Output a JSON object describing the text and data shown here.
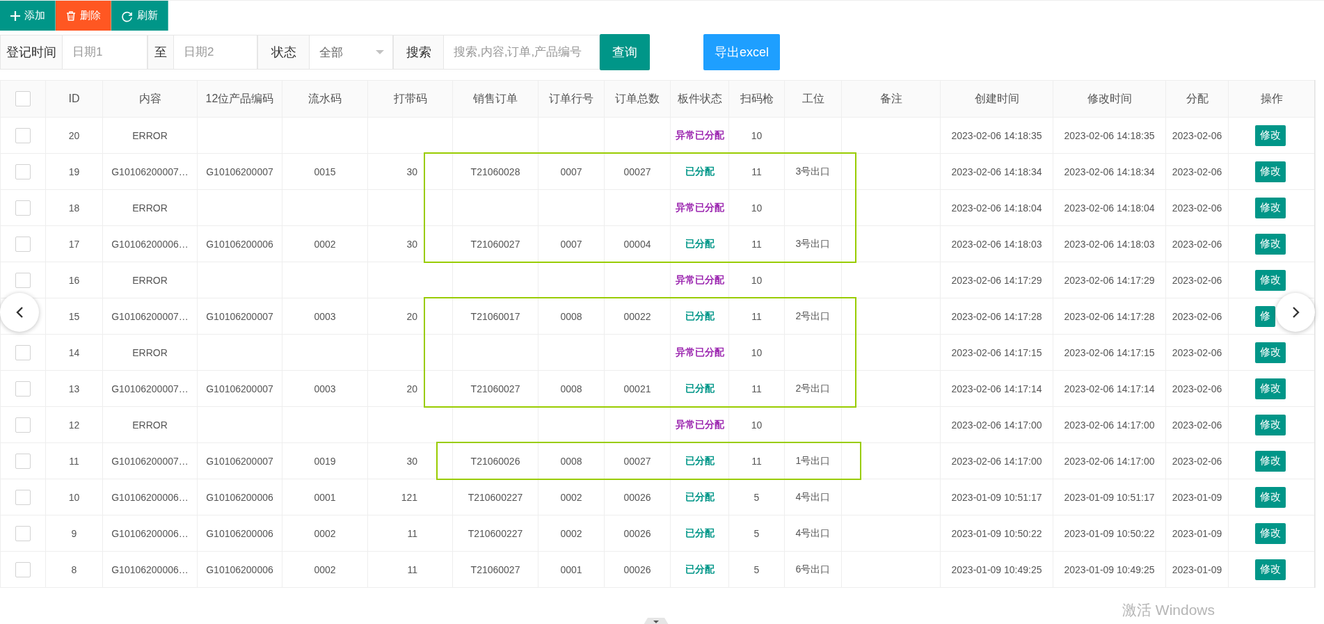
{
  "toolbar": [
    {
      "label": "添加",
      "kind": "add"
    },
    {
      "label": "删除",
      "kind": "delete"
    },
    {
      "label": "刷新",
      "kind": "refresh"
    }
  ],
  "filters": {
    "date_label": "登记时间",
    "date_from": {
      "placeholder": "日期1"
    },
    "range_separator": "至",
    "date_to": {
      "placeholder": "日期2"
    },
    "status_label": "状态",
    "status_value": "全部",
    "search_label": "搜索",
    "search": {
      "placeholder": "搜索,内容,订单,产品编号"
    },
    "query_button": "查询",
    "export_button": "导出excel"
  },
  "table": {
    "select_all": {
      "checked": false
    },
    "columns": [
      "ID",
      "内容",
      "12位产品编码",
      "流水码",
      "打带码",
      "销售订单",
      "订单行号",
      "订单总数",
      "板件状态",
      "扫码枪",
      "工位",
      "备注",
      "创建时间",
      "修改时间",
      "分配",
      "操作"
    ],
    "rows": [
      {
        "checked": false,
        "framed": false,
        "id": "20",
        "content": "ERROR",
        "status": {
          "text": "异常已分配",
          "color": "#9c27b0"
        },
        "scanner": "10",
        "created": "2023-02-06 14:18:35",
        "modified": "2023-02-06 14:18:35",
        "assigned": "2023-02-06",
        "action": "修改"
      },
      {
        "checked": false,
        "framed": true,
        "id": "19",
        "content": "G10106200007…",
        "product_code": "G10106200007",
        "serial": "0015",
        "tape_code": "30",
        "sales_order": "T21060028",
        "line_no": "0007",
        "order_total": "00027",
        "status": {
          "text": "已分配",
          "color": "#009688"
        },
        "scanner": "11",
        "station": "3号出口",
        "created": "2023-02-06 14:18:34",
        "modified": "2023-02-06 14:18:34",
        "assigned": "2023-02-06",
        "action": "修改"
      },
      {
        "checked": false,
        "framed": true,
        "id": "18",
        "content": "ERROR",
        "status": {
          "text": "异常已分配",
          "color": "#9c27b0"
        },
        "scanner": "10",
        "created": "2023-02-06 14:18:04",
        "modified": "2023-02-06 14:18:04",
        "assigned": "2023-02-06",
        "action": "修改"
      },
      {
        "checked": false,
        "framed": true,
        "id": "17",
        "content": "G10106200006…",
        "product_code": "G10106200006",
        "serial": "0002",
        "tape_code": "30",
        "sales_order": "T21060027",
        "line_no": "0007",
        "order_total": "00004",
        "status": {
          "text": "已分配",
          "color": "#009688"
        },
        "scanner": "11",
        "station": "3号出口",
        "created": "2023-02-06 14:18:03",
        "modified": "2023-02-06 14:18:03",
        "assigned": "2023-02-06",
        "action": "修改"
      },
      {
        "checked": false,
        "framed": false,
        "id": "16",
        "content": "ERROR",
        "status": {
          "text": "异常已分配",
          "color": "#9c27b0"
        },
        "scanner": "10",
        "created": "2023-02-06 14:17:29",
        "modified": "2023-02-06 14:17:29",
        "assigned": "2023-02-06",
        "action": "修改"
      },
      {
        "framed": true,
        "id": "15",
        "content": "G10106200007…",
        "product_code": "G10106200007",
        "serial": "0003",
        "tape_code": "20",
        "sales_order": "T21060017",
        "line_no": "0008",
        "order_total": "00022",
        "status": {
          "text": "已分配",
          "color": "#009688"
        },
        "scanner": "11",
        "station": "2号出口",
        "created": "2023-02-06 14:17:28",
        "modified": "2023-02-06 14:17:28",
        "assigned": "2023-02-06",
        "action": "修"
      },
      {
        "checked": false,
        "framed": true,
        "id": "14",
        "content": "ERROR",
        "status": {
          "text": "异常已分配",
          "color": "#9c27b0"
        },
        "scanner": "10",
        "created": "2023-02-06 14:17:15",
        "modified": "2023-02-06 14:17:15",
        "assigned": "2023-02-06",
        "action": "修改"
      },
      {
        "checked": false,
        "framed": true,
        "id": "13",
        "content": "G10106200007…",
        "product_code": "G10106200007",
        "serial": "0003",
        "tape_code": "20",
        "sales_order": "T21060027",
        "line_no": "0008",
        "order_total": "00021",
        "status": {
          "text": "已分配",
          "color": "#009688"
        },
        "scanner": "11",
        "station": "2号出口",
        "created": "2023-02-06 14:17:14",
        "modified": "2023-02-06 14:17:14",
        "assigned": "2023-02-06",
        "action": "修改"
      },
      {
        "checked": false,
        "framed": false,
        "id": "12",
        "content": "ERROR",
        "status": {
          "text": "异常已分配",
          "color": "#9c27b0"
        },
        "scanner": "10",
        "created": "2023-02-06 14:17:00",
        "modified": "2023-02-06 14:17:00",
        "assigned": "2023-02-06",
        "action": "修改"
      },
      {
        "checked": false,
        "framed": true,
        "id": "11",
        "content": "G10106200007…",
        "product_code": "G10106200007",
        "serial": "0019",
        "tape_code": "30",
        "sales_order": "T21060026",
        "line_no": "0008",
        "order_total": "00027",
        "status": {
          "text": "已分配",
          "color": "#009688"
        },
        "scanner": "11",
        "station": "1号出口",
        "created": "2023-02-06 14:17:00",
        "modified": "2023-02-06 14:17:00",
        "assigned": "2023-02-06",
        "action": "修改"
      },
      {
        "checked": false,
        "framed": false,
        "id": "10",
        "content": "G10106200006…",
        "product_code": "G10106200006",
        "serial": "0001",
        "tape_code": "121",
        "sales_order": "T210600227",
        "line_no": "0002",
        "order_total": "00026",
        "status": {
          "text": "已分配",
          "color": "#009688"
        },
        "scanner": "5",
        "station": "4号出口",
        "created": "2023-01-09 10:51:17",
        "modified": "2023-01-09 10:51:17",
        "assigned": "2023-01-09",
        "action": "修改"
      },
      {
        "checked": false,
        "framed": false,
        "id": "9",
        "content": "G10106200006…",
        "product_code": "G10106200006",
        "serial": "0002",
        "tape_code": "11",
        "sales_order": "T210600227",
        "line_no": "0002",
        "order_total": "00026",
        "status": {
          "text": "已分配",
          "color": "#009688"
        },
        "scanner": "5",
        "station": "4号出口",
        "created": "2023-01-09 10:50:22",
        "modified": "2023-01-09 10:50:22",
        "assigned": "2023-01-09",
        "action": "修改"
      },
      {
        "checked": false,
        "framed": false,
        "id": "8",
        "content": "G10106200006…",
        "product_code": "G10106200006",
        "serial": "0002",
        "tape_code": "11",
        "sales_order": "T21060027",
        "line_no": "0001",
        "order_total": "00026",
        "status": {
          "text": "已分配",
          "color": "#009688"
        },
        "scanner": "5",
        "station": "6号出口",
        "created": "2023-01-09 10:49:25",
        "modified": "2023-01-09 10:49:25",
        "assigned": "2023-01-09",
        "action": "修改"
      }
    ]
  },
  "os_notice": "激活 Windows"
}
